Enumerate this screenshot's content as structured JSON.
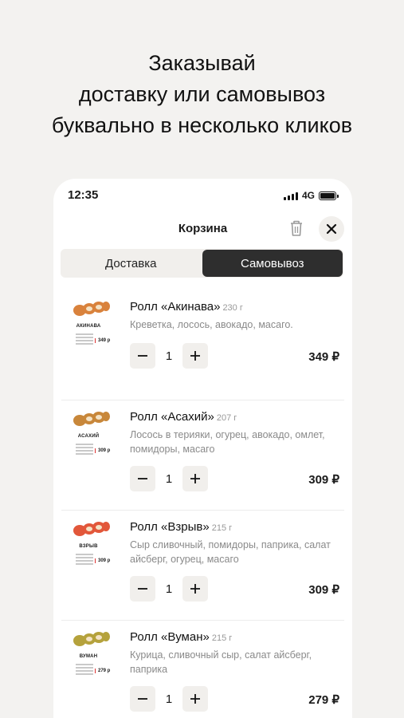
{
  "headline": {
    "line1": "Заказывай",
    "line2": "доставку или самовывоз",
    "line3": "буквально в несколько кликов"
  },
  "status": {
    "time": "12:35",
    "network": "4G"
  },
  "header": {
    "title": "Корзина"
  },
  "tabs": {
    "delivery": "Доставка",
    "pickup": "Самовывоз",
    "active": "pickup"
  },
  "items": [
    {
      "name": "Ролл «Акинава»",
      "weight": "230 г",
      "description": "Креветка, лосось, авокадо, масаго.",
      "thumb_label": "АКИНАВА",
      "thumb_price": "349 р",
      "quantity": "1",
      "price": "349 ₽",
      "roll_color": "#d9823c"
    },
    {
      "name": "Ролл «Асахий»",
      "weight": "207 г",
      "description": "Лосось в терияки, огурец, авокадо, омлет, помидоры, масаго",
      "thumb_label": "АСАХИЙ",
      "thumb_price": "309 р",
      "quantity": "1",
      "price": "309 ₽",
      "roll_color": "#c8873a"
    },
    {
      "name": "Ролл «Взрыв»",
      "weight": "215 г",
      "description": "Сыр сливочный, помидоры, паприка, салат айсберг, огурец, масаго",
      "thumb_label": "ВЗРЫВ",
      "thumb_price": "309 р",
      "quantity": "1",
      "price": "309 ₽",
      "roll_color": "#e2573a"
    },
    {
      "name": "Ролл «Вуман»",
      "weight": "215 г",
      "description": "Курица, сливочный сыр, салат айсберг, паприка",
      "thumb_label": "ВУМАН",
      "thumb_price": "279 р",
      "quantity": "1",
      "price": "279 ₽",
      "roll_color": "#b5a23c"
    }
  ],
  "icons": {
    "trash": "trash-icon",
    "close": "close-icon",
    "minus": "minus-icon",
    "plus": "plus-icon"
  }
}
